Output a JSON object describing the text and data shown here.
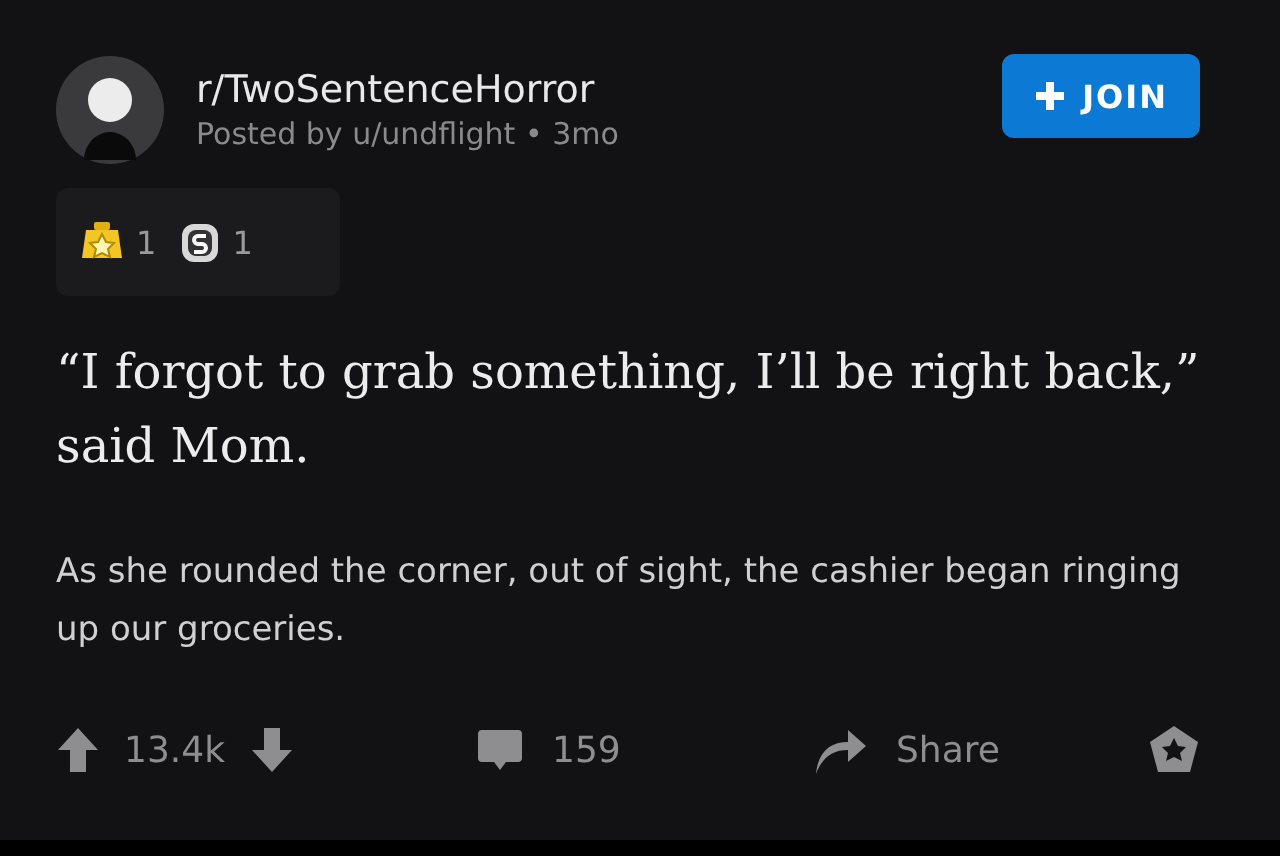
{
  "post": {
    "subreddit": "r/TwoSentenceHorror",
    "meta": "Posted by u/undflight • 3mo",
    "join_button": "JOIN",
    "awards": [
      {
        "kind": "star",
        "count": "1"
      },
      {
        "kind": "coin",
        "count": "1"
      }
    ],
    "title": "“I forgot to grab something, I’ll be right back,” said Mom.",
    "body": "As she rounded the corner, out of sight, the cashier began ringing up our groceries.",
    "votes": "13.4k",
    "comments": "159",
    "share": "Share"
  }
}
